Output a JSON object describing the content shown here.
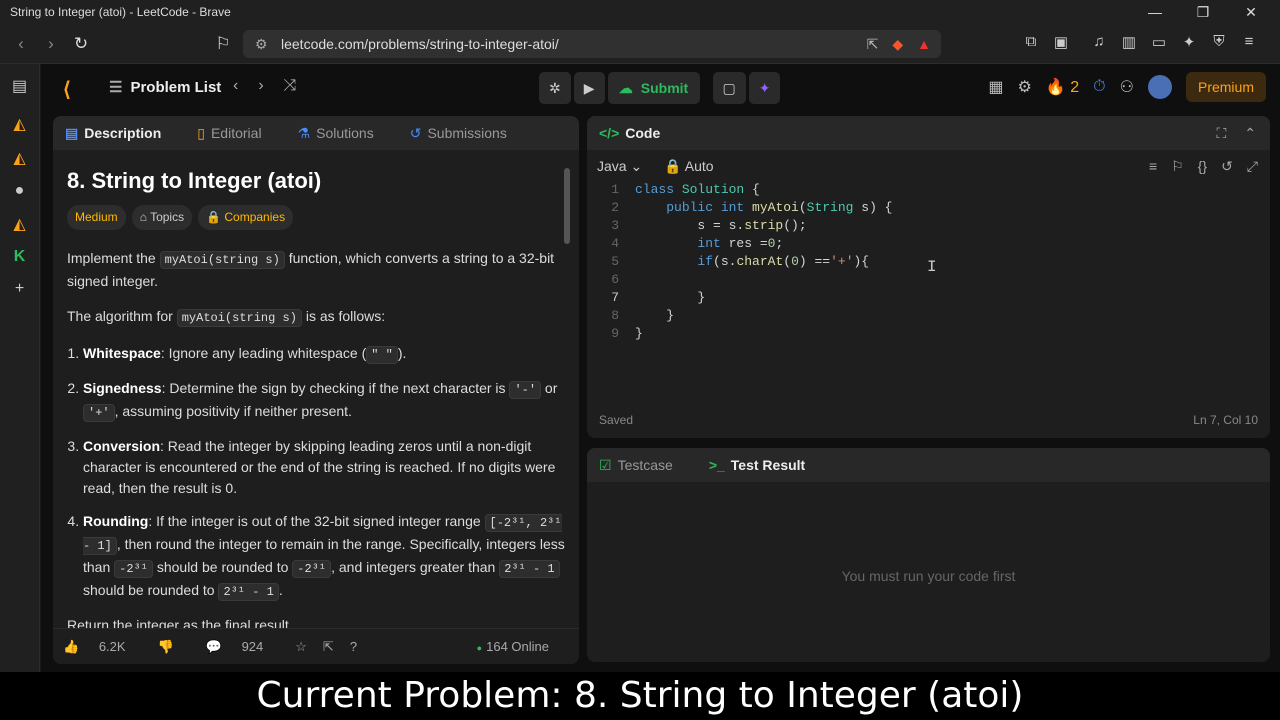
{
  "window": {
    "title": "String to Integer (atoi) - LeetCode - Brave",
    "min": "—",
    "max": "❐",
    "close": "✕"
  },
  "browser": {
    "url": "leetcode.com/problems/string-to-integer-atoi/"
  },
  "nav": {
    "problem_list": "Problem List",
    "submit": "Submit",
    "streak": "2",
    "premium": "Premium"
  },
  "left": {
    "tabs": [
      "Description",
      "Editorial",
      "Solutions",
      "Submissions"
    ],
    "title": "8. String to Integer (atoi)",
    "difficulty": "Medium",
    "topics": "Topics",
    "companies": "Companies",
    "p1_pre": "Implement the ",
    "p1_code": "myAtoi(string s)",
    "p1_post": " function, which converts a string to a 32-bit signed integer.",
    "p2_pre": "The algorithm for ",
    "p2_code": "myAtoi(string s)",
    "p2_post": " is as follows:",
    "steps": [
      {
        "title": "Whitespace",
        "text": ": Ignore any leading whitespace (",
        "code": "\" \"",
        "tail": ")."
      },
      {
        "title": "Signedness",
        "text": ": Determine the sign by checking if the next character is ",
        "code": "'-'",
        "mid": " or ",
        "code2": "'+'",
        "tail": ", assuming positivity if neither present."
      },
      {
        "title": "Conversion",
        "text": ": Read the integer by skipping leading zeros until a non-digit character is encountered or the end of the string is reached. If no digits were read, then the result is 0."
      },
      {
        "title": "Rounding",
        "text": ": If the integer is out of the 32-bit signed integer range ",
        "code": "[-2³¹, 2³¹ - 1]",
        "tail": ", then round the integer to remain in the range. Specifically, integers less than ",
        "code2": "-2³¹",
        "tail2": " should be rounded to ",
        "code3": "-2³¹",
        "tail3": ", and integers greater than ",
        "code4": "2³¹ - 1",
        "tail4": " should be rounded to ",
        "code5": "2³¹ - 1",
        "tail5": "."
      }
    ],
    "return_text": "Return the integer as the final result.",
    "likes": "6.2K",
    "comments": "924",
    "online": "164 Online"
  },
  "code": {
    "header": "Code",
    "language": "Java",
    "mode": "Auto",
    "saved": "Saved",
    "cursor": "Ln 7, Col 10",
    "lines": [
      "1",
      "2",
      "3",
      "4",
      "5",
      "6",
      "7",
      "8",
      "9"
    ]
  },
  "test": {
    "tabs": [
      "Testcase",
      "Test Result"
    ],
    "message": "You must run your code first"
  },
  "caption": "Current Problem: 8. String to Integer (atoi)"
}
